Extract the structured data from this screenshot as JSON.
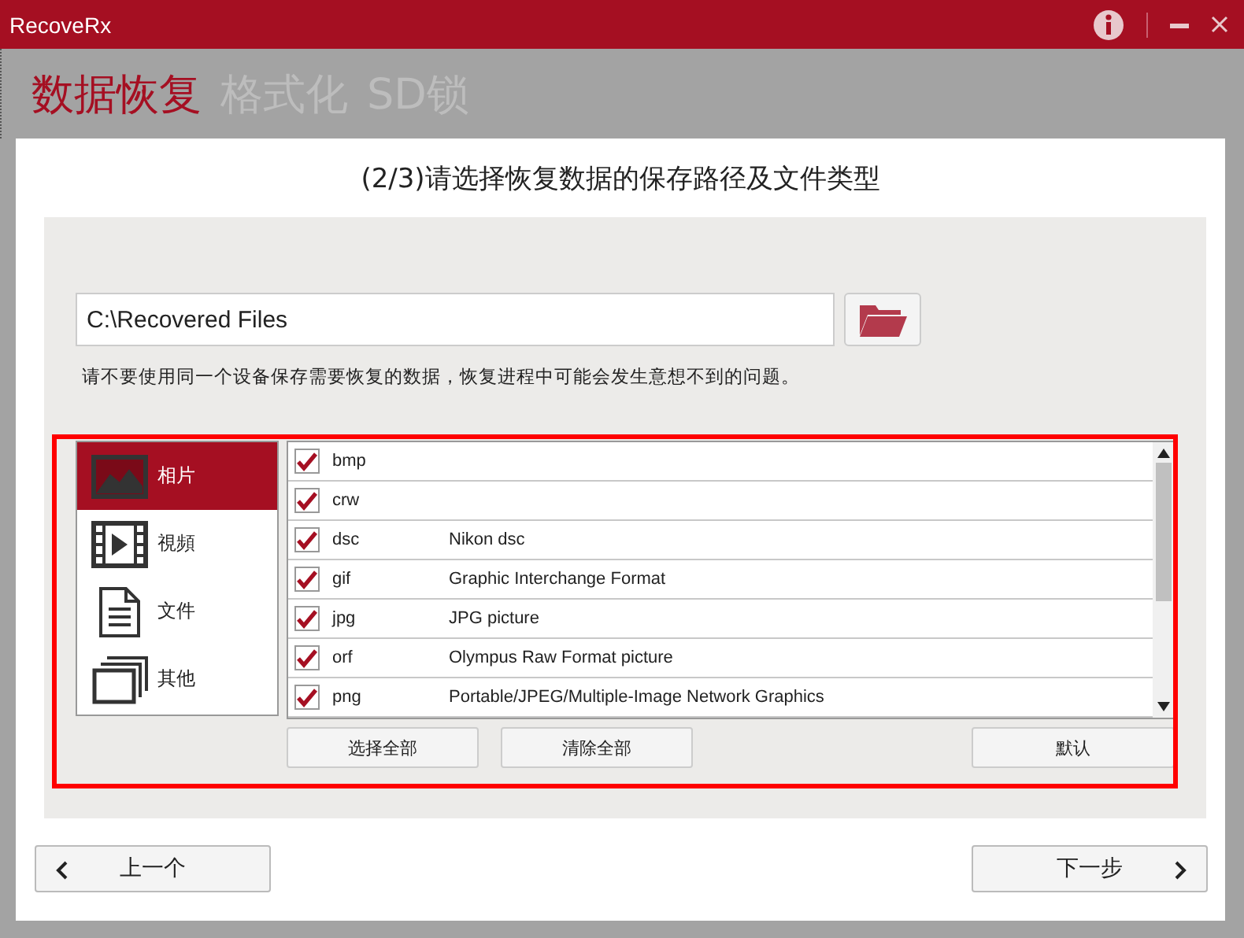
{
  "window": {
    "title": "RecoveRx"
  },
  "nav_tabs": [
    {
      "label": "数据恢复",
      "selected": true
    },
    {
      "label": "格式化",
      "selected": false
    },
    {
      "label": "SD锁",
      "selected": false
    }
  ],
  "step_title": "(2/3)请选择恢复数据的保存路径及文件类型",
  "path_field": {
    "value": "C:\\Recovered Files"
  },
  "warning": "请不要使用同一个设备保存需要恢复的数据，恢复进程中可能会发生意想不到的问题。",
  "categories": [
    {
      "label": "相片",
      "kind": "photo",
      "selected": true
    },
    {
      "label": "視頻",
      "kind": "video",
      "selected": false
    },
    {
      "label": "文件",
      "kind": "document",
      "selected": false
    },
    {
      "label": "其他",
      "kind": "other",
      "selected": false
    }
  ],
  "file_types": [
    {
      "ext": "bmp",
      "checked": true
    },
    {
      "ext": "crw",
      "checked": true
    },
    {
      "ext": "dsc",
      "description": "Nikon dsc",
      "checked": true
    },
    {
      "ext": "gif",
      "description": "Graphic Interchange Format",
      "checked": true
    },
    {
      "ext": "jpg",
      "description": "JPG picture",
      "checked": true
    },
    {
      "ext": "orf",
      "description": "Olympus Raw Format picture",
      "checked": true
    },
    {
      "ext": "png",
      "description": "Portable/JPEG/Multiple-Image Network Graphics",
      "checked": true
    }
  ],
  "list_buttons": [
    "选择全部",
    "清除全部",
    "默认"
  ],
  "nav_buttons": [
    {
      "label": "上一个",
      "kind": "back"
    },
    {
      "label": "下一步",
      "kind": "next"
    }
  ]
}
